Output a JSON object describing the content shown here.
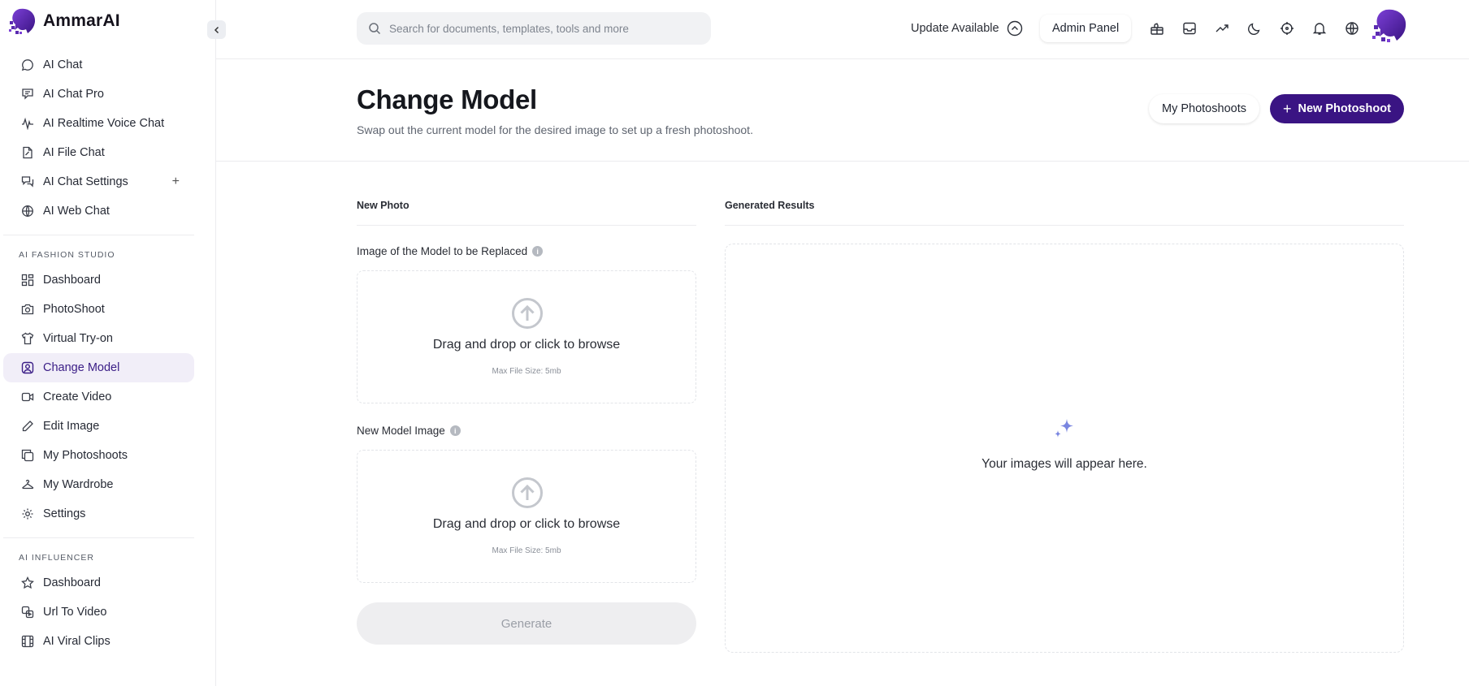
{
  "app": {
    "name": "AmmarAI"
  },
  "sidebar": {
    "items_top": [
      {
        "label": "AI Chat",
        "icon": "chat-bubble-icon"
      },
      {
        "label": "AI Chat Pro",
        "icon": "chat-plus-icon"
      },
      {
        "label": "AI Realtime Voice Chat",
        "icon": "waveform-icon"
      },
      {
        "label": "AI File Chat",
        "icon": "file-icon"
      },
      {
        "label": "AI Chat Settings",
        "icon": "chat-settings-icon",
        "expand": "+"
      },
      {
        "label": "AI Web Chat",
        "icon": "globe-icon"
      }
    ],
    "section_fashion": "AI FASHION STUDIO",
    "items_fashion": [
      {
        "label": "Dashboard",
        "icon": "dashboard-icon"
      },
      {
        "label": "PhotoShoot",
        "icon": "camera-icon"
      },
      {
        "label": "Virtual Try-on",
        "icon": "shirt-icon"
      },
      {
        "label": "Change Model",
        "icon": "user-square-icon",
        "active": true
      },
      {
        "label": "Create Video",
        "icon": "video-icon"
      },
      {
        "label": "Edit Image",
        "icon": "pencil-icon"
      },
      {
        "label": "My Photoshoots",
        "icon": "copy-icon"
      },
      {
        "label": "My Wardrobe",
        "icon": "hanger-icon"
      },
      {
        "label": "Settings",
        "icon": "gear-icon"
      }
    ],
    "section_influencer": "AI INFLUENCER",
    "items_influencer": [
      {
        "label": "Dashboard",
        "icon": "star-icon"
      },
      {
        "label": "Url To Video",
        "icon": "url-video-icon"
      },
      {
        "label": "AI Viral Clips",
        "icon": "film-icon"
      }
    ]
  },
  "header": {
    "search_placeholder": "Search for documents, templates, tools and more",
    "update_label": "Update Available",
    "admin_label": "Admin Panel",
    "icons": [
      "gift-icon",
      "inbox-icon",
      "trending-icon",
      "moon-icon",
      "crosshair-icon",
      "bell-icon",
      "globe-icon"
    ]
  },
  "page": {
    "title": "Change Model",
    "subtitle": "Swap out the current model for the desired image to set up a fresh photoshoot.",
    "my_photoshoots_label": "My Photoshoots",
    "new_photoshoot_label": "New Photoshoot",
    "new_photoshoot_plus": "+"
  },
  "form": {
    "section_title": "New Photo",
    "field1_label": "Image of the Model to be Replaced",
    "field2_label": "New Model Image",
    "info_glyph": "i",
    "drop_text": "Drag and drop or click to browse",
    "drop_size": "Max File Size: 5mb",
    "generate_label": "Generate"
  },
  "results": {
    "section_title": "Generated Results",
    "empty_text": "Your images will appear here."
  },
  "colors": {
    "accent": "#3a1483",
    "active_bg": "#f1eef8",
    "sparkle": "#7a86e0"
  }
}
